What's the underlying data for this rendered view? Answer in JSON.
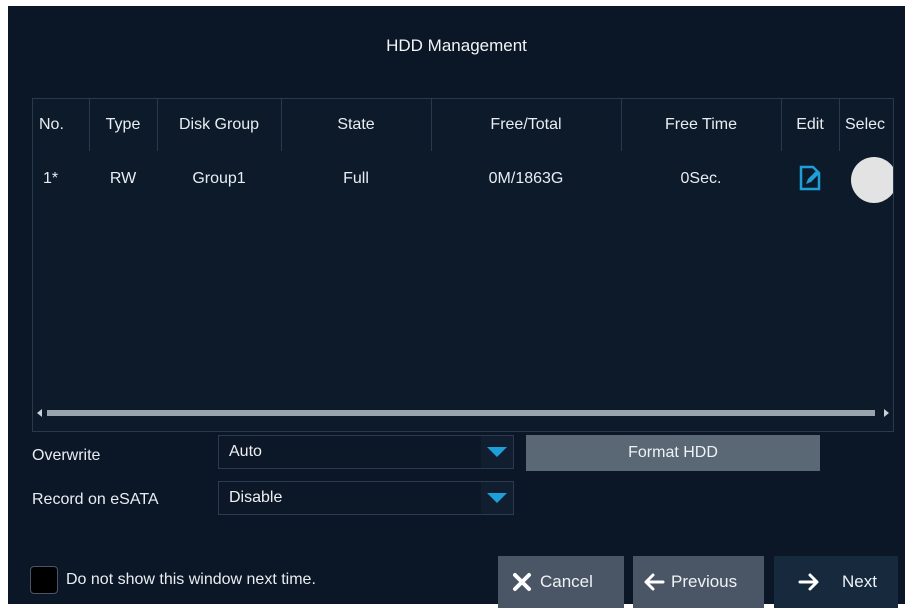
{
  "dialog": {
    "title": "HDD Management"
  },
  "table": {
    "columns": [
      "No.",
      "Type",
      "Disk Group",
      "State",
      "Free/Total",
      "Free Time",
      "Edit",
      "Selec"
    ],
    "rows": [
      {
        "no": "1*",
        "type": "RW",
        "disk_group": "Group1",
        "state": "Full",
        "free_total": "0M/1863G",
        "free_time": "0Sec."
      }
    ]
  },
  "settings": {
    "overwrite_label": "Overwrite",
    "overwrite_value": "Auto",
    "esata_label": "Record on eSATA",
    "esata_value": "Disable",
    "format_button": "Format HDD"
  },
  "footer": {
    "dont_show_label": "Do not show this window next time.",
    "cancel_label": "Cancel",
    "previous_label": "Previous",
    "next_label": "Next"
  },
  "colors": {
    "background": "#0b1726",
    "accent": "#1e9fd9",
    "button": "#4a5665"
  },
  "icons": {
    "edit": "edit-icon",
    "cancel": "close-x-icon",
    "previous": "arrow-left-icon",
    "next": "arrow-right-icon",
    "dropdown": "chevron-down-icon"
  }
}
